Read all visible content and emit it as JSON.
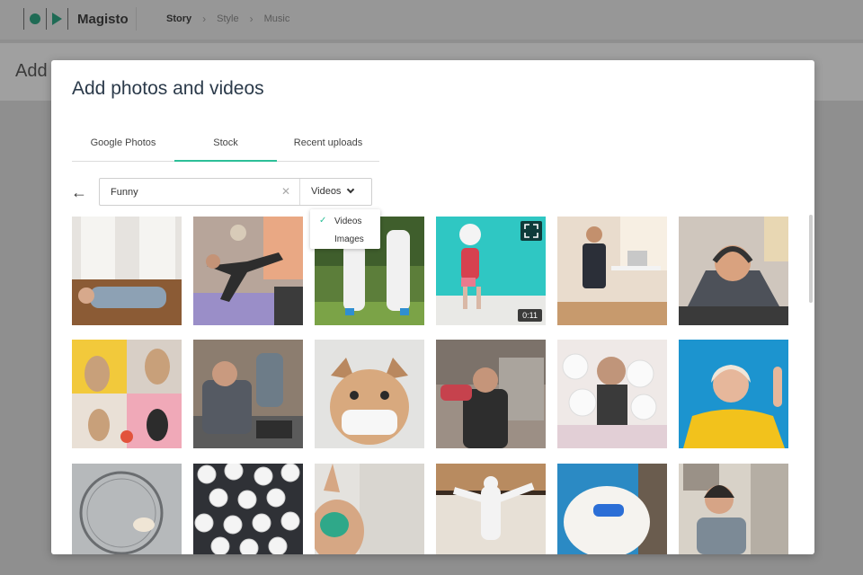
{
  "app": {
    "brand": "Magisto",
    "breadcrumbs": [
      "Story",
      "Style",
      "Music"
    ],
    "active_crumb": "Story",
    "background_title": "Add"
  },
  "modal": {
    "title": "Add photos and videos",
    "tabs": [
      {
        "label": "Google Photos",
        "active": false
      },
      {
        "label": "Stock",
        "active": true
      },
      {
        "label": "Recent uploads",
        "active": false
      }
    ],
    "search": {
      "value": "Funny",
      "clear_icon": "close-icon"
    },
    "media_type": {
      "selected": "Videos",
      "options": [
        {
          "label": "Videos",
          "checked": true
        },
        {
          "label": "Images",
          "checked": false
        }
      ]
    },
    "grid": [
      {
        "name": "tile-kid-floor-doorway"
      },
      {
        "name": "tile-yoga-with-dog"
      },
      {
        "name": "tile-hazmat-suits-grass"
      },
      {
        "name": "tile-panda-mask-dancer",
        "duration": "0:11",
        "expand_icon": "expand-icon"
      },
      {
        "name": "tile-man-desk-office"
      },
      {
        "name": "tile-man-pushup-headphones"
      },
      {
        "name": "tile-dogs-video-call"
      },
      {
        "name": "tile-frustrated-man-laptop"
      },
      {
        "name": "tile-pug-face-mask"
      },
      {
        "name": "tile-man-falling-kitchen"
      },
      {
        "name": "tile-man-toilet-paper"
      },
      {
        "name": "tile-woman-yellow-blue"
      },
      {
        "name": "tile-hamster-wheel"
      },
      {
        "name": "tile-toilet-paper-rolls"
      },
      {
        "name": "tile-rabbit-mask"
      },
      {
        "name": "tile-man-dancing-hazmat"
      },
      {
        "name": "tile-fluffy-dog-sunglasses"
      },
      {
        "name": "tile-woman-laughing-headset"
      }
    ]
  },
  "colors": {
    "accent": "#2cbf98",
    "brand_green": "#1f6b55"
  }
}
